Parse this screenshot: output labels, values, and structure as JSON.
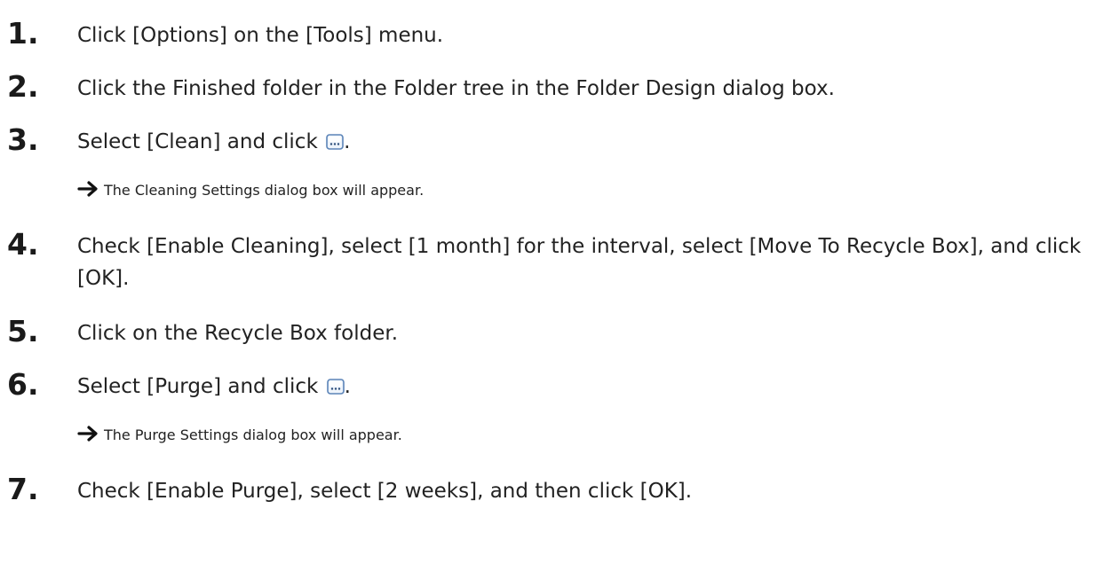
{
  "steps": [
    {
      "number": "1.",
      "before": "Click [Options] on the [Tools] menu.",
      "after": ""
    },
    {
      "number": "2.",
      "before": "Click the Finished folder in the Folder tree in the Folder Design dialog box.",
      "after": ""
    },
    {
      "number": "3.",
      "before": "Select [Clean] and click ",
      "after": "."
    },
    {
      "number": "4.",
      "before": "Check [Enable Cleaning], select [1 month] for the interval, select [Move To Recycle Box], and click [OK].",
      "after": ""
    },
    {
      "number": "5.",
      "before": "Click on the Recycle Box folder.",
      "after": ""
    },
    {
      "number": "6.",
      "before": "Select [Purge] and click ",
      "after": "."
    },
    {
      "number": "7.",
      "before": "Check [Enable Purge], select [2 weeks], and then click [OK].",
      "after": ""
    }
  ],
  "results": [
    {
      "text": "The Cleaning Settings dialog box will appear."
    },
    {
      "text": "The Purge Settings dialog box will appear."
    }
  ],
  "icons": {
    "browse_button": "ellipsis-button-icon",
    "result_arrow": "right-arrow-icon"
  },
  "colors": {
    "text": "#222222",
    "icon_frame": "#5b84b8",
    "icon_fill": "#eef4fb"
  }
}
